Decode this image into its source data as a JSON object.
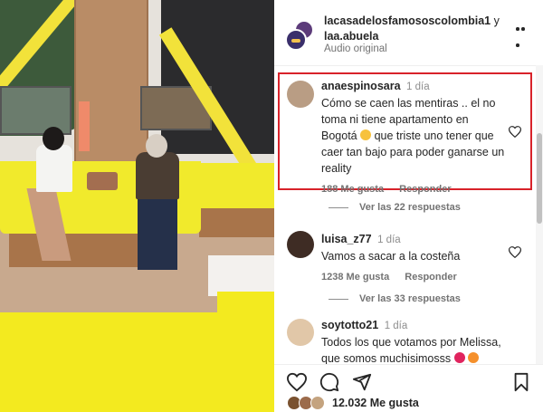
{
  "post": {
    "author_primary": "lacasadelosfamososcolombia1",
    "author_joiner": "y",
    "author_secondary": "laa.abuela",
    "audio": "Audio original"
  },
  "comments": [
    {
      "user": "anaespinosara",
      "time": "1 día",
      "text_a": "Cómo se caen las mentiras .. el no toma ni tiene apartamento en Bogotá",
      "text_b": "que triste uno tener que caer tan bajo para poder ganarse un reality",
      "emoji": "laughing-crying-emoji",
      "likes": "188 Me gusta",
      "reply_label": "Responder",
      "view_replies": "Ver las 22 respuestas",
      "highlighted": true
    },
    {
      "user": "luisa_z77",
      "time": "1 día",
      "text_a": "Vamos a sacar a la costeña",
      "likes": "1238 Me gusta",
      "reply_label": "Responder",
      "view_replies": "Ver las 33 respuestas"
    },
    {
      "user": "soytotto21",
      "time": "1 día",
      "text_a": "Todos los que votamos por Melissa, que somos muchisimosss",
      "emojis": [
        "red-heart-emoji",
        "fire-emoji"
      ]
    }
  ],
  "likes_summary": "12.032 Me gusta",
  "icons": {
    "more": "more-options-icon",
    "like": "heart-icon",
    "comment": "comment-icon",
    "share": "share-icon",
    "save": "bookmark-icon"
  },
  "colors": {
    "highlight": "#d8222a",
    "text": "#262626",
    "muted": "#737373"
  }
}
